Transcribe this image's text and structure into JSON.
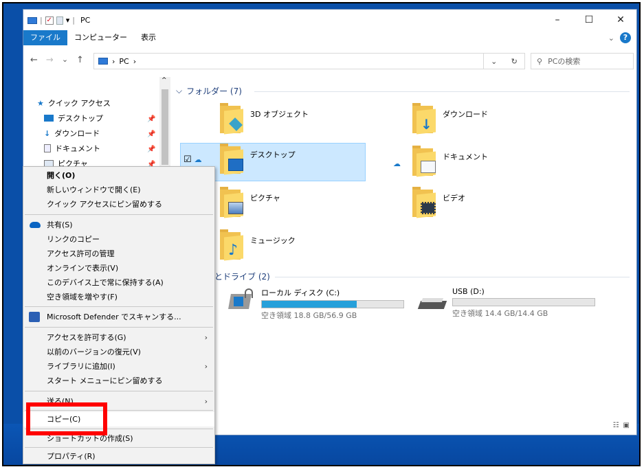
{
  "window": {
    "title": "PC",
    "minimize": "–",
    "maximize": "☐",
    "close": "✕"
  },
  "ribbon": {
    "tabs": [
      "ファイル",
      "コンピューター",
      "表示"
    ]
  },
  "address": {
    "back": "←",
    "forward": "→",
    "recent": "⌄",
    "up": "↑",
    "path": "PC",
    "sep": "›",
    "dropdown": "⌄",
    "refresh": "↻",
    "search_placeholder": "PCの検索"
  },
  "nav": {
    "quick_access": "クイック アクセス",
    "items": [
      "デスクトップ",
      "ダウンロード",
      "ドキュメント",
      "ピクチャ"
    ]
  },
  "content": {
    "folders_header": "フォルダー (7)",
    "devices_header": "とドライブ (2)",
    "folders": [
      "3D オブジェクト",
      "ダウンロード",
      "デスクトップ",
      "ドキュメント",
      "ピクチャ",
      "ビデオ",
      "ミュージック"
    ],
    "drives": [
      {
        "name": "ローカル ディスク (C:)",
        "space": "空き領域 18.8 GB/56.9 GB",
        "used_fraction": 0.67
      },
      {
        "name": "USB (D:)",
        "space": "空き領域 14.4 GB/14.4 GB",
        "used_fraction": 0.0
      }
    ]
  },
  "context_menu": {
    "items": [
      "開く(O)",
      "新しいウィンドウで開く(E)",
      "クイック アクセスにピン留めする",
      "共有(S)",
      "リンクのコピー",
      "アクセス許可の管理",
      "オンラインで表示(V)",
      "このデバイス上で常に保持する(A)",
      "空き領域を増やす(F)",
      "Microsoft Defender でスキャンする...",
      "アクセスを許可する(G)",
      "以前のバージョンの復元(V)",
      "ライブラリに追加(I)",
      "スタート メニューにピン留めする",
      "送る(N)",
      "コピー(C)",
      "ショートカットの作成(S)",
      "プロパティ(R)"
    ]
  },
  "colors": {
    "accent": "#1979ca",
    "selection": "#cce8ff",
    "highlight_box": "#ff0000",
    "desktop": "#0a4fa8"
  }
}
